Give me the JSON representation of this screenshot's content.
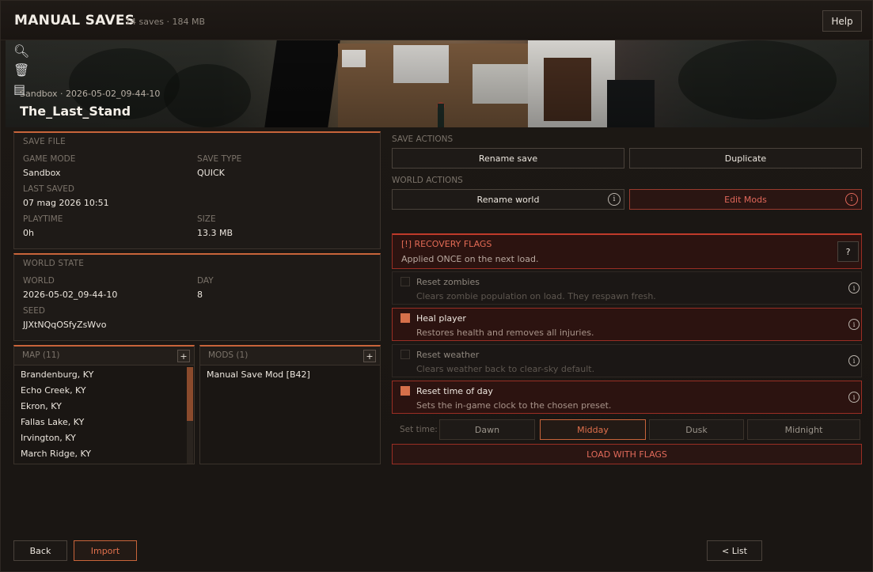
{
  "header": {
    "title": "MANUAL SAVES",
    "meta": "14 saves · 184 MB",
    "help_label": "Help"
  },
  "banner": {
    "meta": "Sandbox · 2026-05-02_09-44-10",
    "save_name": "The_Last_Stand",
    "icons": [
      "magnifier-icon",
      "trash-icon",
      "folder-icon"
    ]
  },
  "save_file": {
    "title": "SAVE FILE",
    "game_mode_label": "GAME MODE",
    "game_mode": "Sandbox",
    "save_type_label": "SAVE TYPE",
    "save_type": "QUICK",
    "last_saved_label": "LAST SAVED",
    "last_saved": "07 mag 2026 10:51",
    "playtime_label": "PLAYTIME",
    "playtime": "0h",
    "size_label": "SIZE",
    "size": "13.3 MB"
  },
  "world_state": {
    "title": "WORLD STATE",
    "world_label": "WORLD",
    "world": "2026-05-02_09-44-10",
    "day_label": "DAY",
    "day": "8",
    "seed_label": "SEED",
    "seed": "JJXtNQqOSfyZsWvo"
  },
  "map_list": {
    "title": "MAP (11)",
    "items": [
      "Brandenburg, KY",
      "Echo Creek, KY",
      "Ekron, KY",
      "Fallas Lake, KY",
      "Irvington, KY",
      "March Ridge, KY"
    ]
  },
  "mods_list": {
    "title": "MODS (1)",
    "items": [
      "Manual Save Mod [B42]"
    ]
  },
  "save_actions": {
    "title": "SAVE ACTIONS",
    "rename_save": "Rename save",
    "duplicate": "Duplicate"
  },
  "world_actions": {
    "title": "WORLD ACTIONS",
    "rename_world": "Rename world",
    "edit_mods": "Edit Mods"
  },
  "recovery": {
    "title": "[!] RECOVERY FLAGS",
    "subtitle": "Applied ONCE on the next load.",
    "help": "?",
    "flags": [
      {
        "name": "Reset zombies",
        "desc": "Clears zombie population on load. They respawn fresh.",
        "checked": false
      },
      {
        "name": "Heal player",
        "desc": "Restores health and removes all injuries.",
        "checked": true
      },
      {
        "name": "Reset weather",
        "desc": "Clears weather back to clear-sky default.",
        "checked": false
      },
      {
        "name": "Reset time of day",
        "desc": "Sets the in-game clock to the chosen preset.",
        "checked": true
      }
    ],
    "set_time_label": "Set time:",
    "time_options": [
      "Dawn",
      "Midday",
      "Dusk",
      "Midnight"
    ],
    "selected_time": "Midday",
    "load_label": "LOAD WITH FLAGS"
  },
  "footer": {
    "back": "Back",
    "import": "Import",
    "list": "< List"
  },
  "colors": {
    "accent": "#c8643a",
    "warning": "#e0675a",
    "background": "#1c1814"
  }
}
